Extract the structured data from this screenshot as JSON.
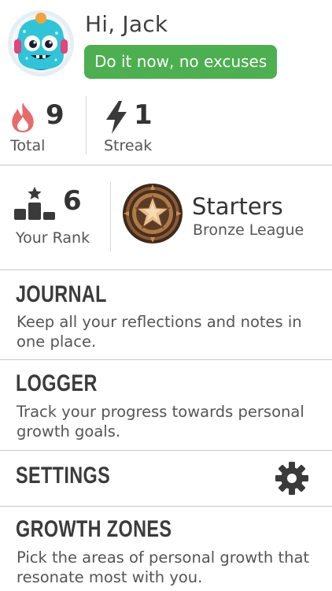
{
  "header": {
    "greeting": "Hi, Jack",
    "motto": "Do it now, no excuses",
    "avatar_icon": "monster-avatar-icon"
  },
  "stats": {
    "total": {
      "value": "9",
      "label": "Total",
      "icon": "flame-icon"
    },
    "streak": {
      "value": "1",
      "label": "Streak",
      "icon": "lightning-icon"
    }
  },
  "rank": {
    "value": "6",
    "label": "Your Rank",
    "icon": "podium-star-icon",
    "league": {
      "name": "Starters",
      "tier": "Bronze League",
      "icon": "bronze-star-badge-icon"
    }
  },
  "menu": {
    "journal": {
      "title": "JOURNAL",
      "desc": "Keep all your reflections and notes in one place."
    },
    "logger": {
      "title": "LOGGER",
      "desc": "Track your progress towards personal growth goals."
    },
    "settings": {
      "title": "SETTINGS",
      "icon": "gear-icon"
    },
    "growth": {
      "title": "GROWTH ZONES",
      "desc": "Pick the areas of personal growth that resonate most with you."
    }
  },
  "colors": {
    "accent_green": "#4caf50",
    "flame": "#e35d5d",
    "divider": "#c9c9c9",
    "text_dark": "#3b3b3b",
    "text_muted": "#555555"
  }
}
